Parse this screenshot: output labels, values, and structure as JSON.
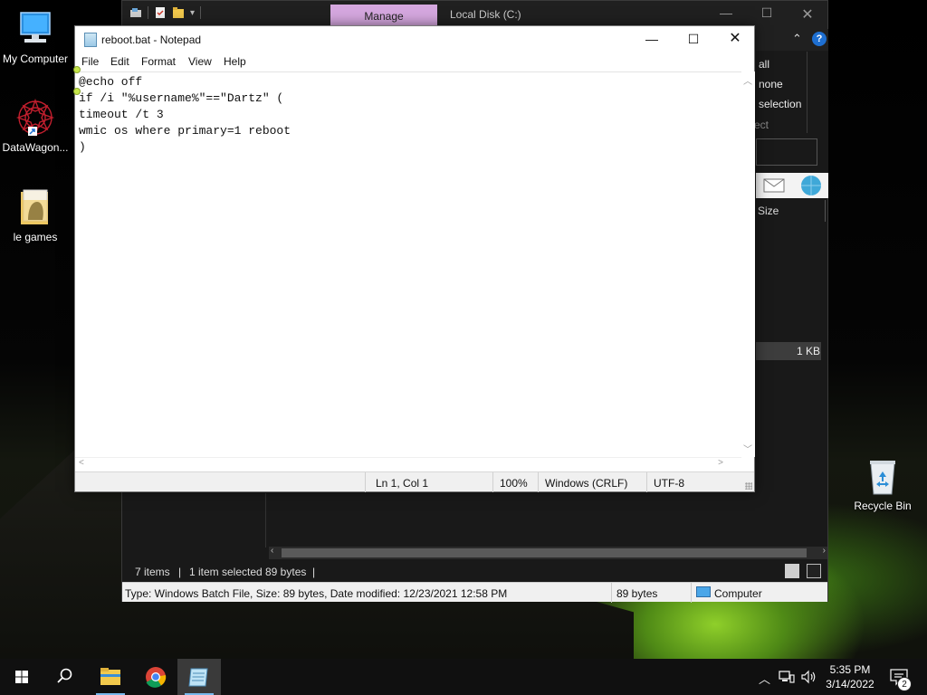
{
  "desktop": {
    "icons": [
      {
        "label": "My Computer",
        "icon": "monitor-icon"
      },
      {
        "label": "DataWagon...",
        "icon": "mandala-shortcut-icon"
      },
      {
        "label": "le games",
        "icon": "folder-icon"
      },
      {
        "label": "Recycle Bin",
        "icon": "recycle-bin-icon"
      }
    ]
  },
  "explorer": {
    "manage_tab": "Manage",
    "title": "Local Disk (C:)",
    "ribbon": {
      "select_all": "all",
      "select_none": "none",
      "invert_selection": "selection",
      "group_label": "ect"
    },
    "column_size": "Size",
    "selected_row_size": "1 KB",
    "status": {
      "items": "7 items",
      "separator": "|",
      "selected": "1 item selected",
      "bytes": "89 bytes"
    },
    "infobar": {
      "details": "Type: Windows Batch File, Size: 89 bytes, Date modified: 12/23/2021 12:58 PM",
      "size": "89 bytes",
      "location": "Computer"
    }
  },
  "notepad": {
    "title": "reboot.bat - Notepad",
    "menu": [
      "File",
      "Edit",
      "Format",
      "View",
      "Help"
    ],
    "content": "@echo off\nif /i \"%username%\"==\"Dartz\" (\ntimeout /t 3\nwmic os where primary=1 reboot\n)",
    "status": {
      "position": "Ln 1, Col 1",
      "zoom": "100%",
      "line_ending": "Windows (CRLF)",
      "encoding": "UTF-8"
    }
  },
  "taskbar": {
    "pinned": [
      "start-icon",
      "search-icon",
      "file-explorer-icon",
      "chrome-icon",
      "notepad-icon"
    ],
    "time": "5:35 PM",
    "date": "3/14/2022",
    "notification_count": "2"
  },
  "colors": {
    "manage_tab": "#d5a7df",
    "accent": "#1e6fd1",
    "wallpaper_glow": "#8fcf2a"
  }
}
